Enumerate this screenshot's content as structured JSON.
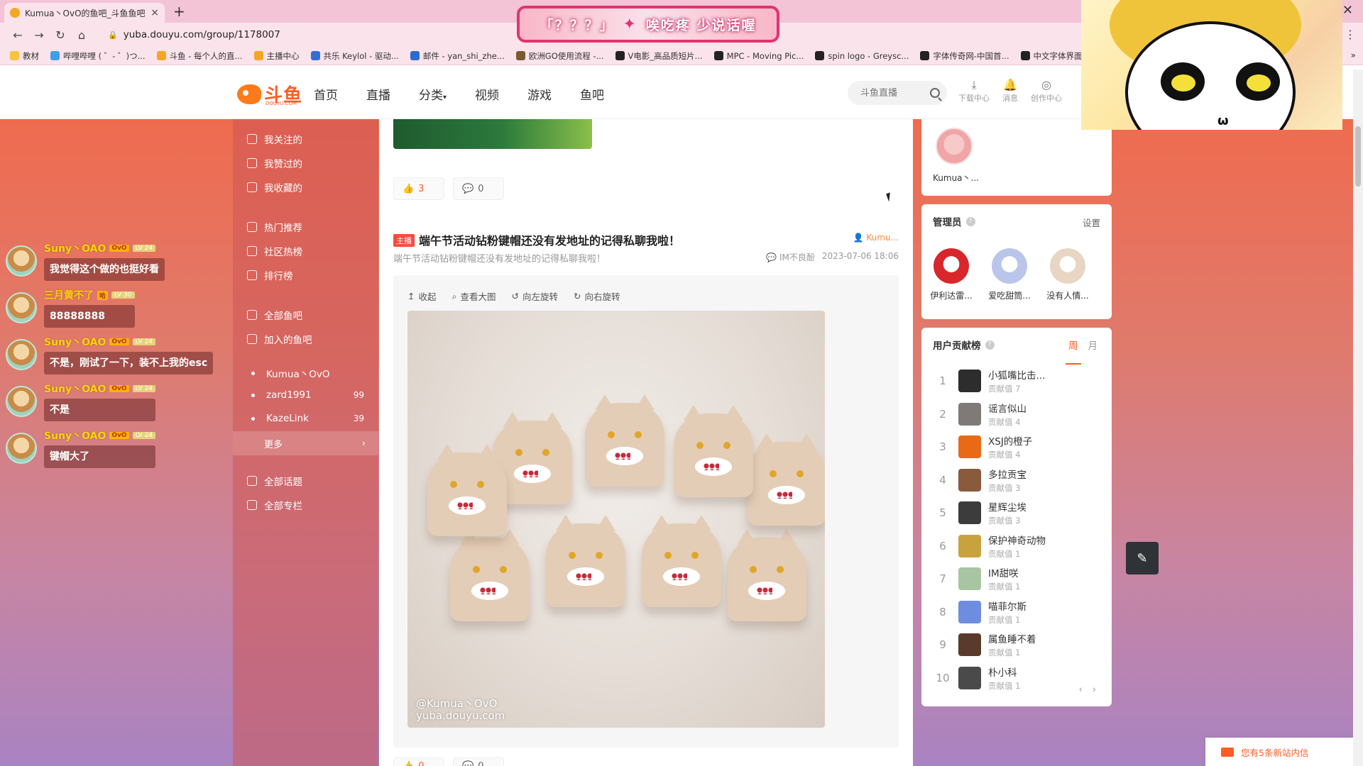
{
  "browser": {
    "tab_title": "Kumua丶OvO的鱼吧_斗鱼鱼吧",
    "tab_close": "×",
    "new_tab": "+",
    "url": "yuba.douyu.com/group/1178007",
    "bookmarks": [
      {
        "label": "教材",
        "color": "#f6c342"
      },
      {
        "label": "哔哩哔哩 ( ゜- ゜)つ...",
        "color": "#3aa0e8"
      },
      {
        "label": "斗鱼 - 每个人的直...",
        "color": "#f5a623"
      },
      {
        "label": "主播中心",
        "color": "#f5a623"
      },
      {
        "label": "共乐 Keylol - 驱动...",
        "color": "#2f6fd6"
      },
      {
        "label": "邮件 - yan_shi_zhe...",
        "color": "#2a6ccf"
      },
      {
        "label": "欧洲GO使用流程 -...",
        "color": "#7a5b2e"
      },
      {
        "label": "V电影_高品质短片...",
        "color": "#222222"
      },
      {
        "label": "MPC - Moving Pic...",
        "color": "#222222"
      },
      {
        "label": "spin logo - Greysc...",
        "color": "#222222"
      },
      {
        "label": "字体传奇网-中国首...",
        "color": "#222222"
      },
      {
        "label": "中文字体界面",
        "color": "#222222"
      }
    ],
    "bookmarks_more": "»"
  },
  "header": {
    "logo_text": "斗鱼",
    "logo_sub": "DOUYU.COM",
    "nav": [
      {
        "label": "首页"
      },
      {
        "label": "直播"
      },
      {
        "label": "分类",
        "caret": "▾"
      },
      {
        "label": "视频"
      },
      {
        "label": "游戏"
      },
      {
        "label": "鱼吧"
      }
    ],
    "search_placeholder": "斗鱼直播",
    "icons": [
      {
        "label": "下载中心",
        "glyph": "⤓",
        "icon": "download-icon"
      },
      {
        "label": "消息",
        "glyph": "🔔",
        "icon": "bell-icon"
      },
      {
        "label": "创作中心",
        "glyph": "◎",
        "icon": "bulb-icon"
      }
    ]
  },
  "stream_overlay": {
    "banner_left": "「？？？」",
    "banner_star": "✦",
    "banner_right": "唉吃疼 少说话喔"
  },
  "chat": [
    {
      "user": "Suny丶OAO",
      "badge": "OvO",
      "level": "LV 24",
      "text": "我觉得这个做的也挺好看"
    },
    {
      "user": "三月黄不了",
      "badge": "哈",
      "level": "LV 30",
      "text": "88888888"
    },
    {
      "user": "Suny丶OAO",
      "badge": "OvO",
      "level": "LV 24",
      "text": "不是，刚试了一下，装不上我的esc"
    },
    {
      "user": "Suny丶OAO",
      "badge": "OvO",
      "level": "LV 24",
      "text": "不是"
    },
    {
      "user": "Suny丶OAO",
      "badge": "OvO",
      "level": "LV 24",
      "text": "键帽大了"
    }
  ],
  "sidebar": {
    "group1": [
      "我关注的",
      "我赞过的",
      "我收藏的"
    ],
    "group2": [
      "热门推荐",
      "社区热榜",
      "排行榜"
    ],
    "group3": [
      "全部鱼吧",
      "加入的鱼吧"
    ],
    "joined": [
      {
        "name": "Kumua丶OvO",
        "count": ""
      },
      {
        "name": "zard1991",
        "count": "99"
      },
      {
        "name": "KazeLink",
        "count": "39"
      }
    ],
    "more": "更多",
    "more_chev": "›",
    "group4": [
      "全部话题",
      "全部专栏"
    ]
  },
  "feed": {
    "prev_like": "3",
    "prev_comment": "0",
    "post": {
      "tag": "主播",
      "title": "端午节活动钻粉键帽还没有发地址的记得私聊我啦！",
      "author": "Kumu...",
      "subtitle": "端午节活动钻粉键帽还没有发地址的记得私聊我啦！",
      "source": "IM不良酚",
      "date": "2023-07-06 18:06",
      "tools": [
        "收起",
        "查看大图",
        "向左旋转",
        "向右旋转"
      ],
      "watermark_line1": "@Kumua丶OvO",
      "watermark_line2": "yuba.douyu.com",
      "next_like": "0",
      "next_comment": "0"
    }
  },
  "right": {
    "owner_name": "Kumua丶...",
    "admins_title": "管理员",
    "admins_help": "?",
    "settings": "设置",
    "admins": [
      {
        "name": "伊利达雷...",
        "color": "#d8262b"
      },
      {
        "name": "爱吃甜筒...",
        "color": "#b9c6ea"
      },
      {
        "name": "没有人情...",
        "color": "#e9d5c3"
      }
    ],
    "rank_title": "用户贡献榜",
    "rank_help": "?",
    "tab_week": "周",
    "tab_month": "月",
    "ranking": [
      {
        "rank": "1",
        "name": "小狐嘴比击...",
        "score": "贡献值 7",
        "color": "#2d2d2d"
      },
      {
        "rank": "2",
        "name": "谣言似山",
        "score": "贡献值 4",
        "color": "#7f7a78"
      },
      {
        "rank": "3",
        "name": "XSJ的橙子",
        "score": "贡献值 4",
        "color": "#e86a17"
      },
      {
        "rank": "4",
        "name": "多拉贡宝",
        "score": "贡献值 3",
        "color": "#8a5a3c"
      },
      {
        "rank": "5",
        "name": "星辉尘埃",
        "score": "贡献值 3",
        "color": "#3c3c3c"
      },
      {
        "rank": "6",
        "name": "保护神奇动物",
        "score": "贡献值 1",
        "color": "#c8a23d"
      },
      {
        "rank": "7",
        "name": "IM甜咲",
        "score": "贡献值 1",
        "color": "#a7c5a0"
      },
      {
        "rank": "8",
        "name": "喵菲尔斯",
        "score": "贡献值 1",
        "color": "#6f8de0"
      },
      {
        "rank": "9",
        "name": "属鱼睡不着",
        "score": "贡献值 1",
        "color": "#5a3a2a"
      },
      {
        "rank": "10",
        "name": "朴小科",
        "score": "贡献值 1",
        "color": "#4a4a4a"
      }
    ],
    "pager_prev": "‹",
    "pager_next": "›"
  },
  "notice": "您有5条新站内信",
  "edit_glyph": "✎"
}
